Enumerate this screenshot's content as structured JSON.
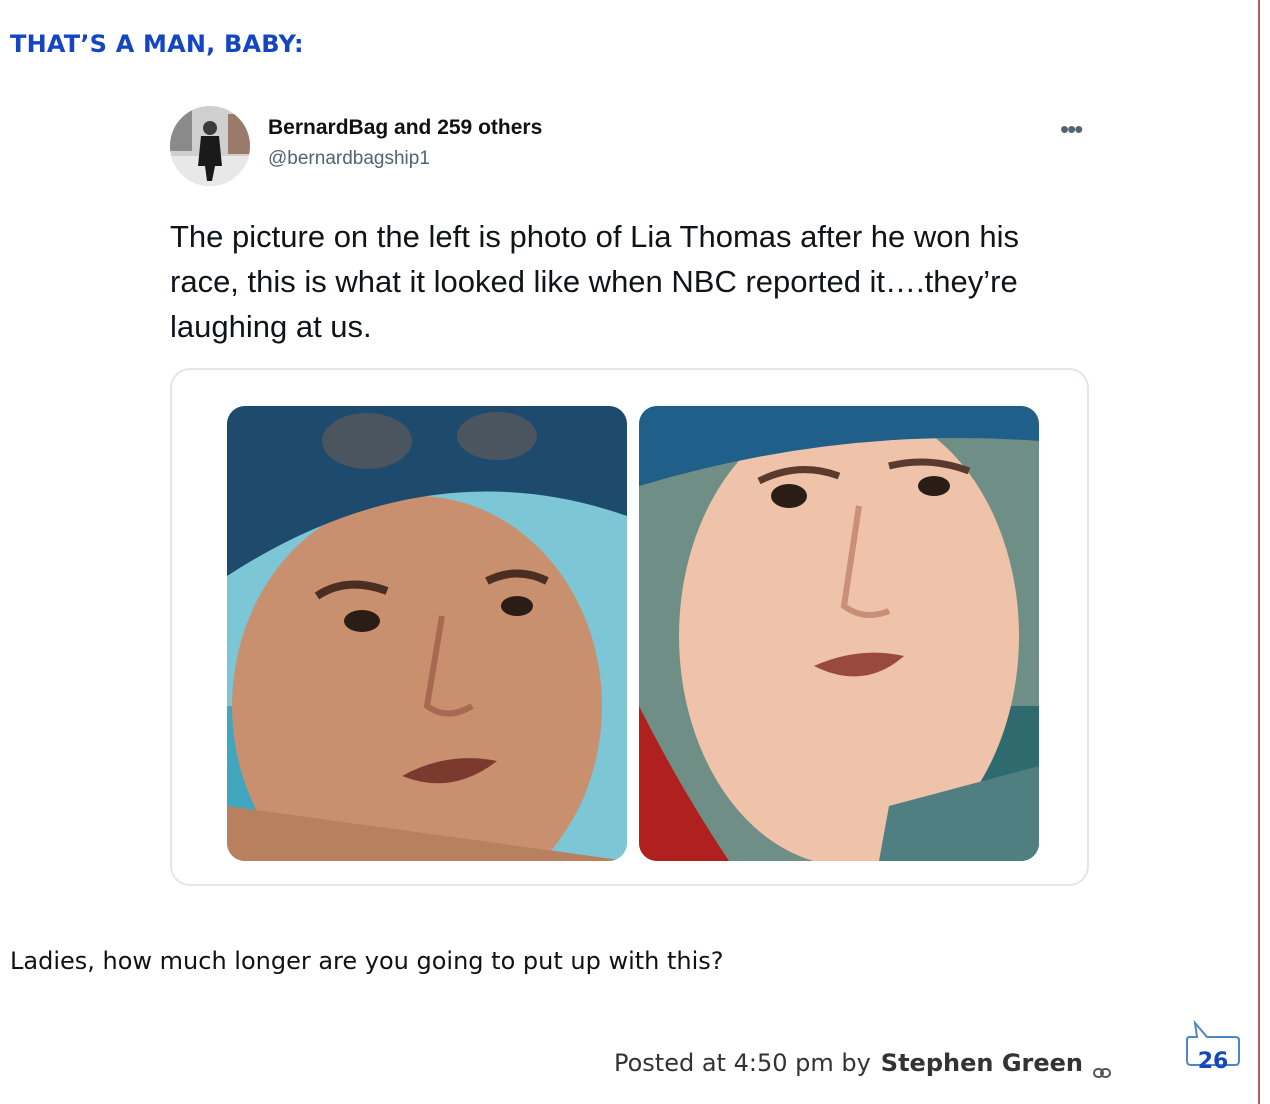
{
  "post": {
    "title": "THAT’S A MAN, BABY:",
    "body": "Ladies, how much longer are you going to put up with this?",
    "footer": {
      "posted_at": "Posted at 4:50 pm by",
      "author": "Stephen Green",
      "comment_count": "26"
    }
  },
  "tweet": {
    "display_name": "BernardBag and 259 others",
    "handle": "@bernardbagship1",
    "more_icon": "•••",
    "text": "The picture on the left is photo of Lia Thomas after he won his race, this is what it looked like when NBC reported it….they’re laughing at us."
  },
  "colors": {
    "title_blue": "#1446c2",
    "rule_red": "#b25a5a"
  }
}
